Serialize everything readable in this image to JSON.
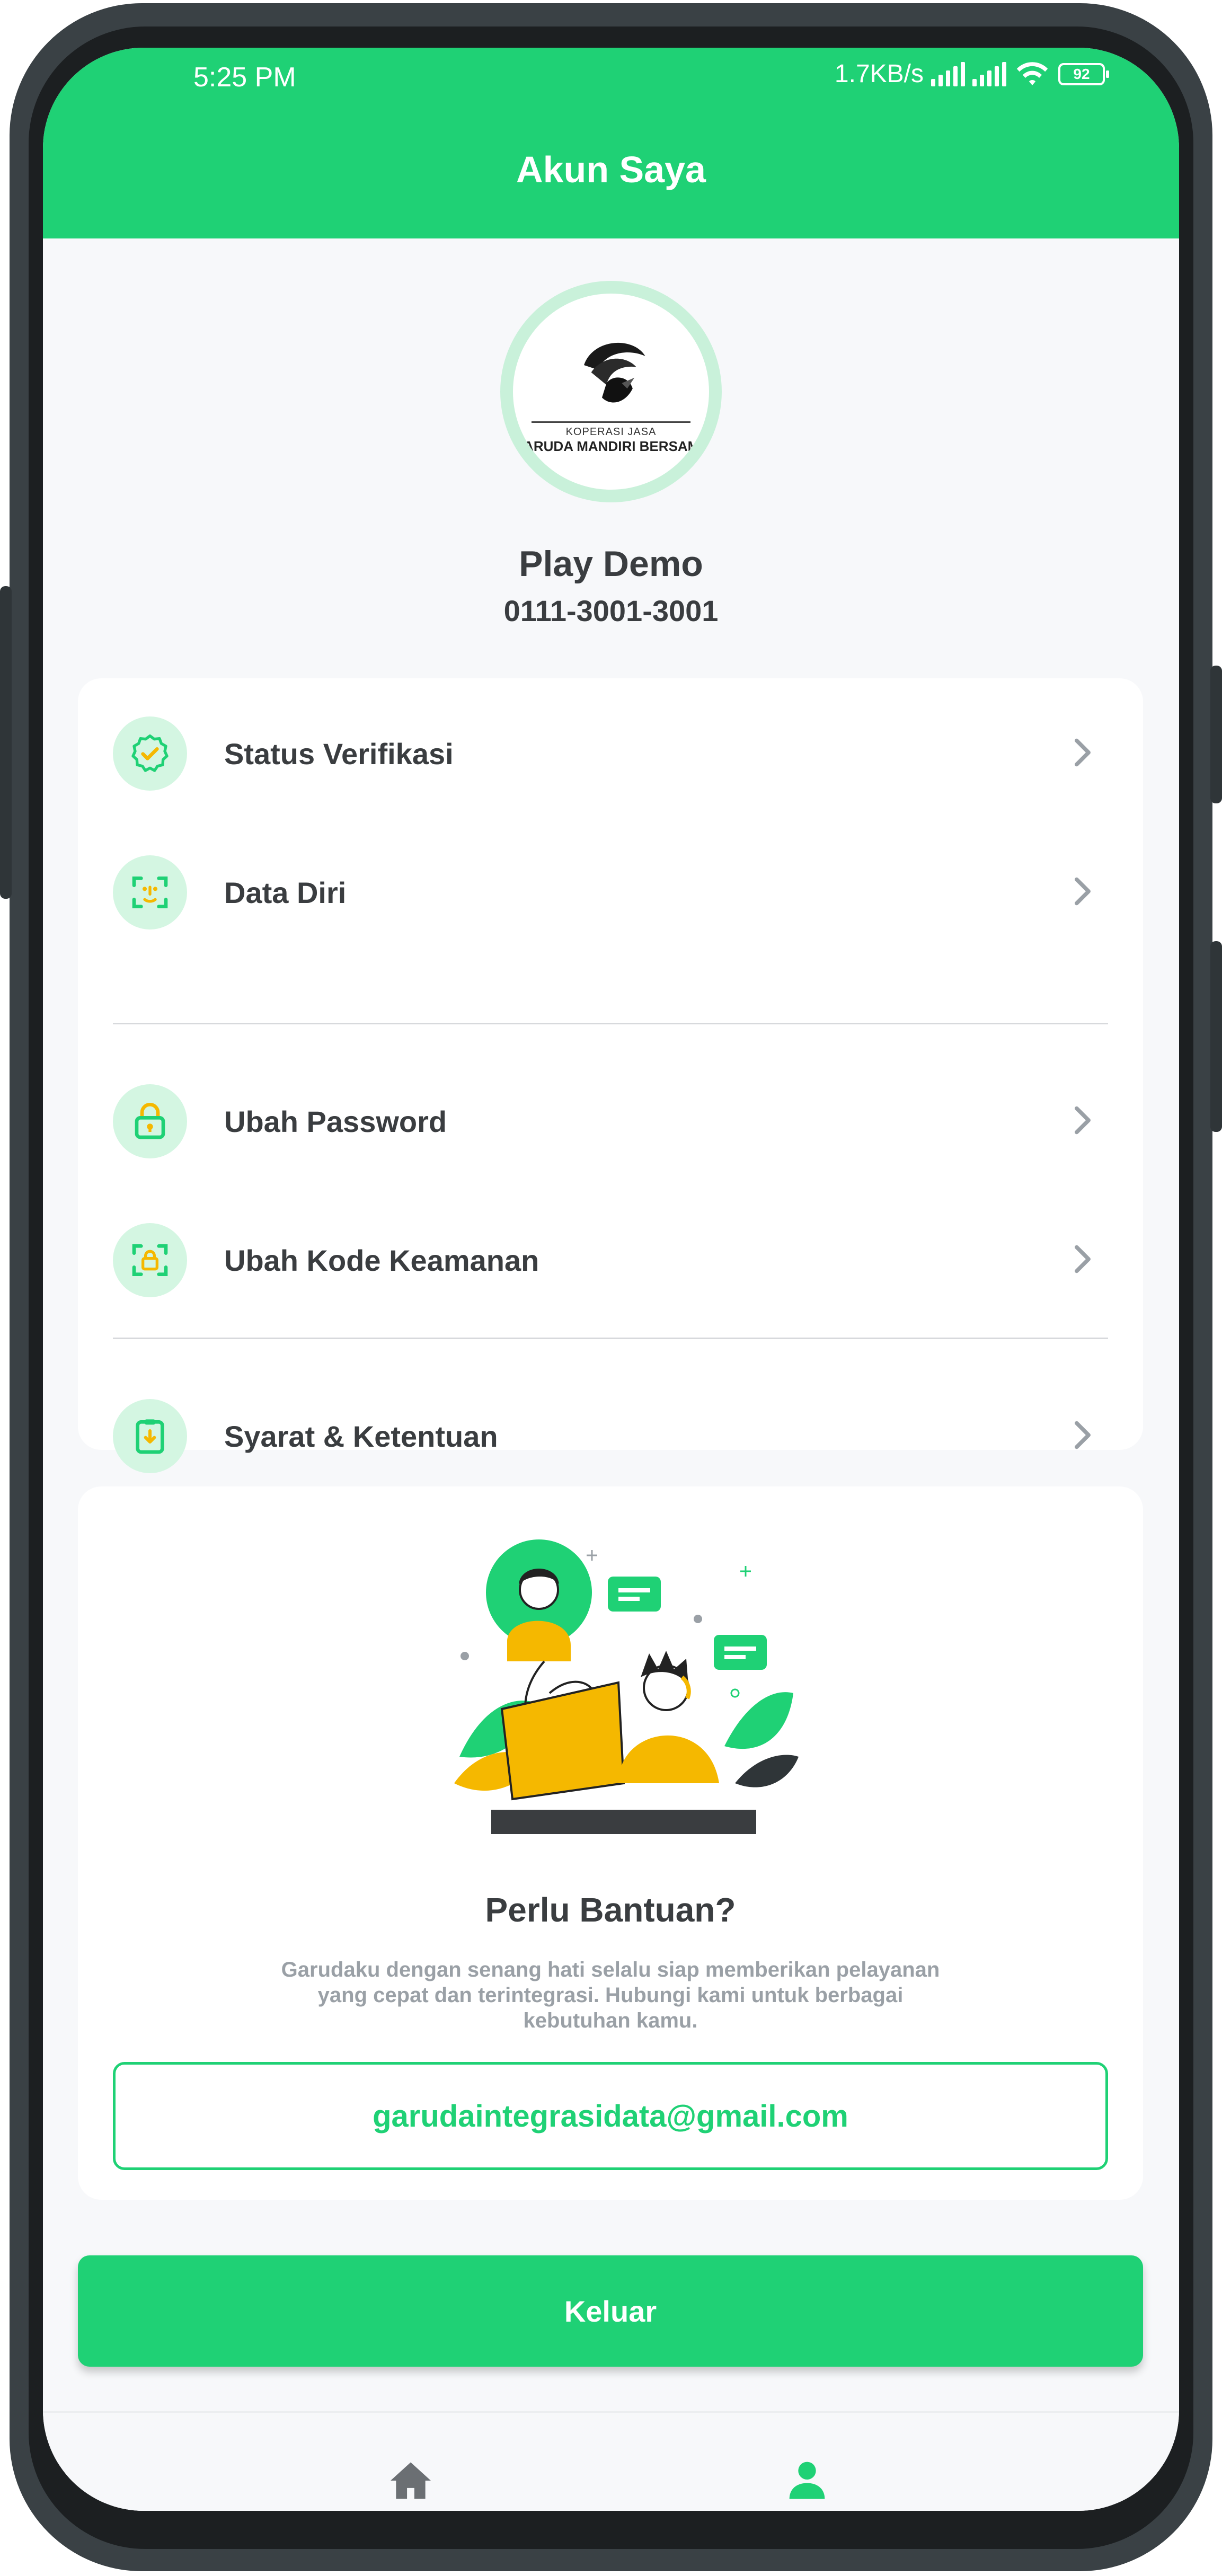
{
  "status_bar": {
    "time": "5:25 PM",
    "network_speed": "1.7KB/s",
    "battery": "92"
  },
  "header": {
    "title": "Akun Saya"
  },
  "profile": {
    "logo_line1": "KOPERASI JASA",
    "logo_line2": "GARUDA MANDIRI BERSAMA",
    "name": "Play Demo",
    "phone": "0111-3001-3001"
  },
  "menu": {
    "items": [
      {
        "label": "Status Verifikasi",
        "icon": "verified-badge-icon"
      },
      {
        "label": "Data Diri",
        "icon": "face-scan-icon"
      },
      {
        "label": "Ubah Password",
        "icon": "lock-icon"
      },
      {
        "label": "Ubah Kode Keamanan",
        "icon": "lock-scan-icon"
      },
      {
        "label": "Syarat & Ketentuan",
        "icon": "clipboard-download-icon"
      }
    ]
  },
  "help": {
    "title": "Perlu Bantuan?",
    "description": "Garudaku dengan senang hati selalu siap memberikan pelayanan yang cepat dan terintegrasi. Hubungi kami untuk berbagai kebutuhan kamu.",
    "email": "garudaintegrasidata@gmail.com"
  },
  "logout": {
    "label": "Keluar"
  },
  "bottom_nav": {
    "items": [
      {
        "icon": "home-icon",
        "active": false
      },
      {
        "icon": "profile-icon",
        "active": true
      }
    ]
  },
  "colors": {
    "primary": "#1fd175",
    "icon_bg": "#d4f6e2",
    "icon_accent": "#f5b800",
    "text": "#3a3d40",
    "muted": "#9aa0a6"
  }
}
